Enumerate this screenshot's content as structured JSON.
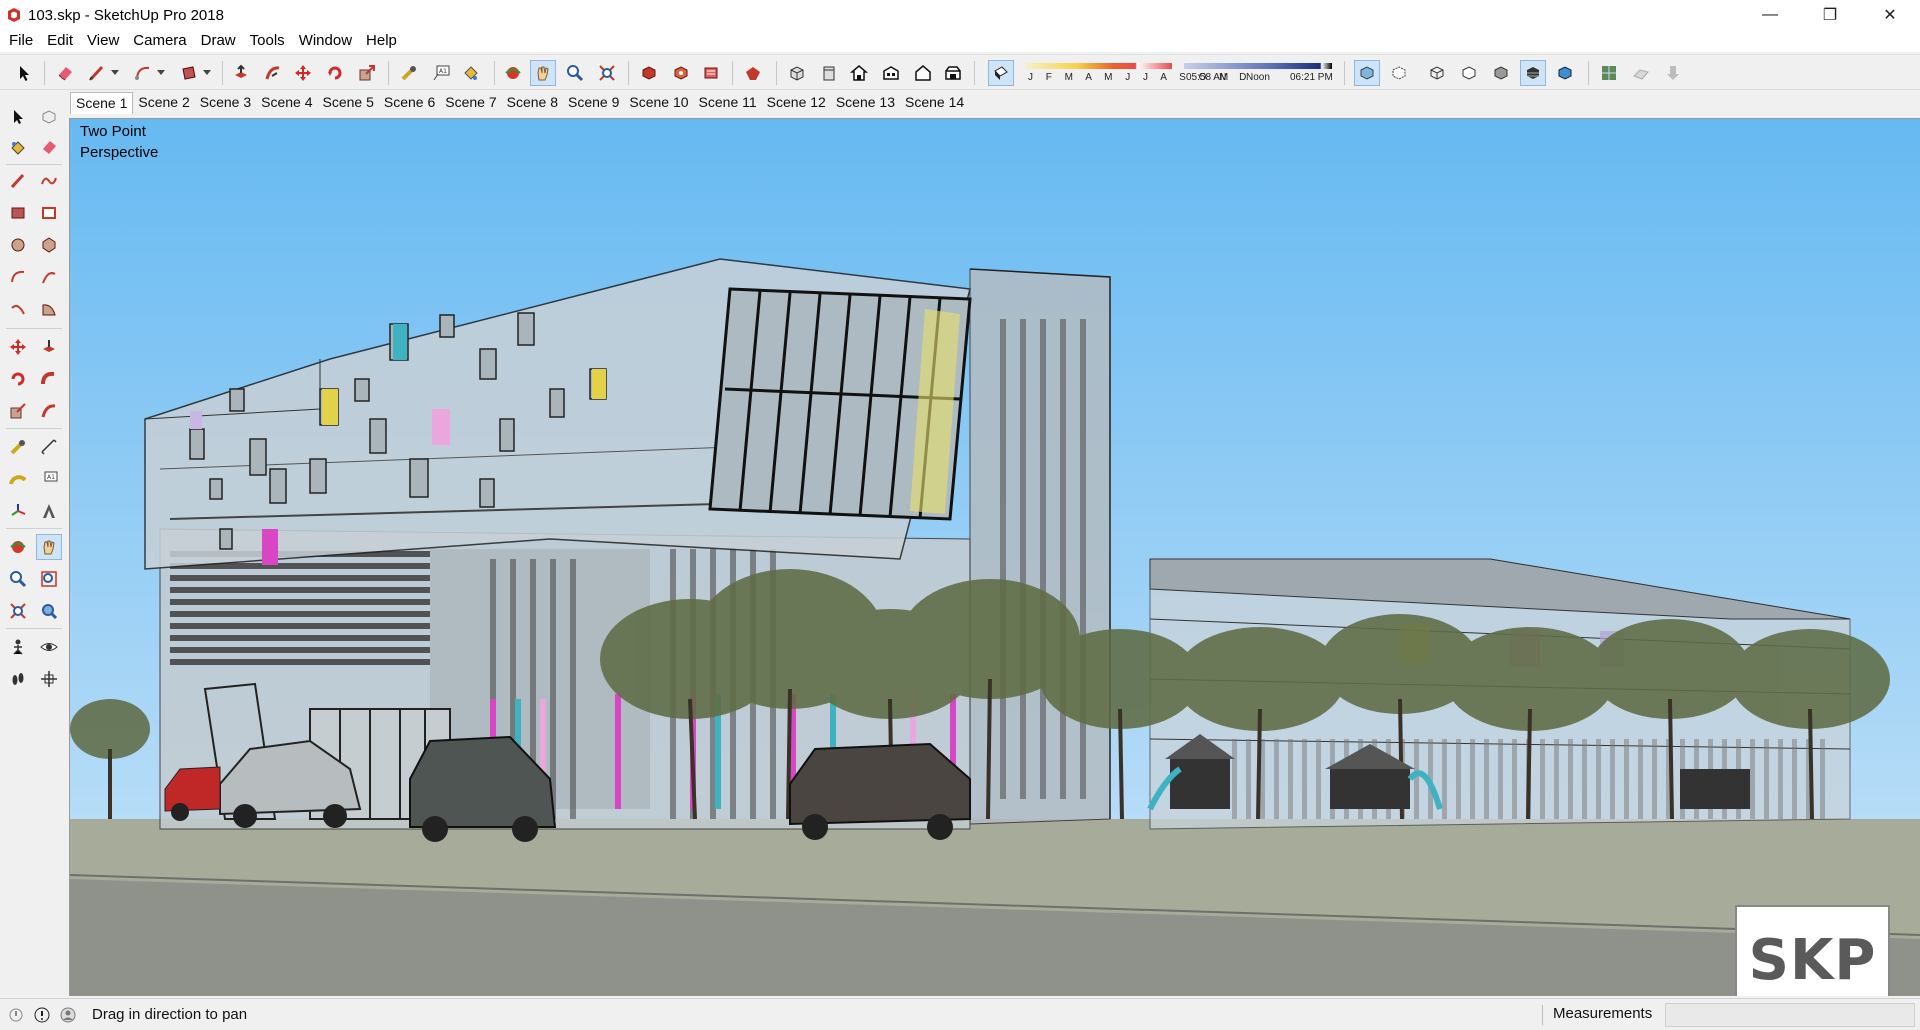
{
  "window": {
    "title": "103.skp - SketchUp Pro 2018",
    "controls": {
      "minimize": "—",
      "restore": "❐",
      "close": "✕"
    }
  },
  "menu": [
    "File",
    "Edit",
    "View",
    "Camera",
    "Draw",
    "Tools",
    "Window",
    "Help"
  ],
  "toolbar": {
    "shadow_months": "J F M A M J J A S O N D",
    "shadow_times": {
      "start": "05:58 AM",
      "mid": "Noon",
      "end": "06:21 PM"
    }
  },
  "scenes": {
    "active_index": 0,
    "tabs": [
      "Scene 1",
      "Scene 2",
      "Scene 3",
      "Scene 4",
      "Scene 5",
      "Scene 6",
      "Scene 7",
      "Scene 8",
      "Scene 9",
      "Scene 10",
      "Scene 11",
      "Scene 12",
      "Scene 13",
      "Scene 14"
    ]
  },
  "viewport": {
    "camera_line1": "Two Point",
    "camera_line2": "Perspective",
    "badge": "SKP",
    "sky_color": "#7cc4f4",
    "ground_color": "#a7ab9a",
    "road_color": "#8f918b"
  },
  "status": {
    "hint": "Drag in direction to pan",
    "measurements_label": "Measurements",
    "measurements_value": ""
  }
}
